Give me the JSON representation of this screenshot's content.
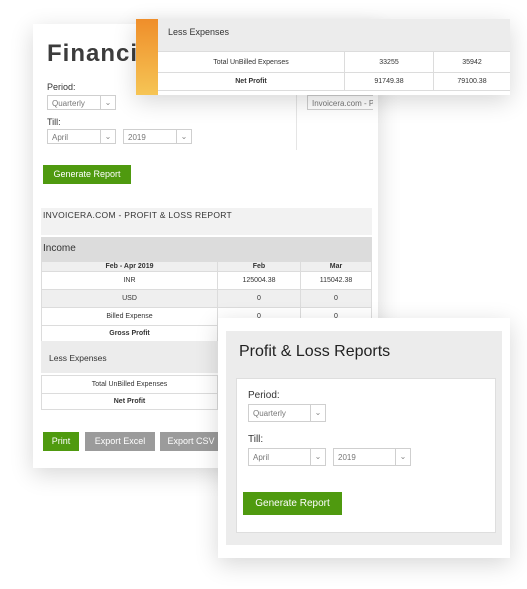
{
  "back_card": {
    "title": "Financia",
    "period_label": "Period:",
    "period_value": "Quarterly",
    "till_label": "Till:",
    "till_month": "April",
    "till_year": "2019",
    "side_field": "Invoicera.com - Profit",
    "generate_button": "Generate Report",
    "report_title": "INVOICERA.COM - PROFIT & LOSS REPORT",
    "income_heading": "Income",
    "columns": [
      "Feb - Apr 2019",
      "Feb",
      "Mar"
    ],
    "rows": [
      {
        "label": "INR",
        "feb": "125004.38",
        "mar": "115042.38"
      },
      {
        "label": "USD",
        "feb": "0",
        "mar": "0"
      },
      {
        "label": "Billed Expense",
        "feb": "0",
        "mar": "0"
      },
      {
        "label": "Gross Profit",
        "feb": "",
        "mar": ""
      }
    ],
    "less_expenses": "Less Expenses",
    "total_unbilled": "Total UnBilled Expenses",
    "net_profit": "Net Profit",
    "print_button": "Print",
    "export_excel_button": "Export Excel",
    "export_csv_button": "Export CSV"
  },
  "top_card": {
    "heading": "Less Expenses",
    "rows": [
      {
        "label": "Total UnBilled Expenses",
        "v1": "33255",
        "v2": "35942"
      },
      {
        "label": "Net Profit",
        "v1": "91749.38",
        "v2": "79100.38"
      }
    ]
  },
  "front_card": {
    "title": "Profit & Loss Reports",
    "period_label": "Period:",
    "period_value": "Quarterly",
    "till_label": "Till:",
    "till_month": "April",
    "till_year": "2019",
    "generate_button": "Generate Report"
  },
  "colors": {
    "accent_green": "#4f9a0f",
    "accent_orange": "#f0a030",
    "button_gray": "#9b9b9b"
  }
}
